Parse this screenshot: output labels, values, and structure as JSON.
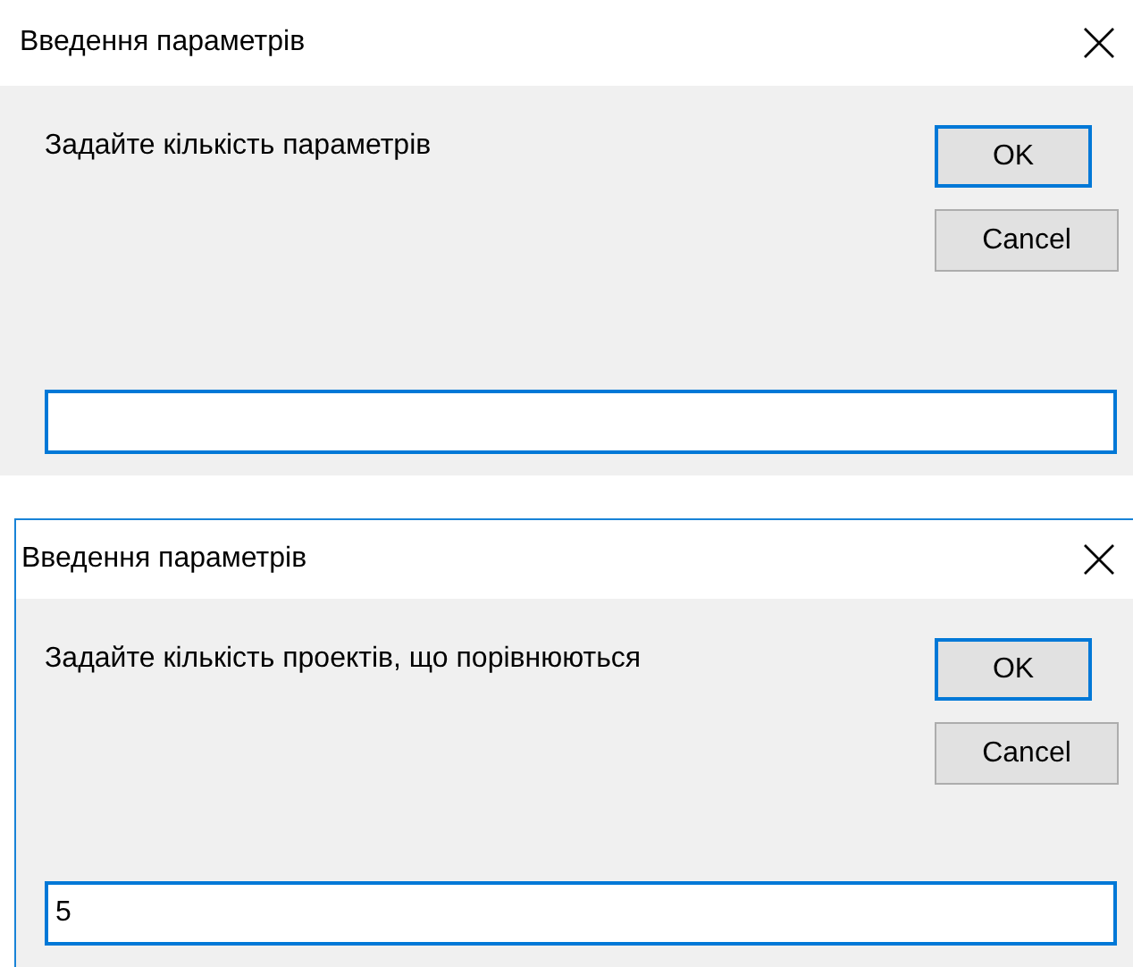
{
  "dialogs": [
    {
      "title": "Введення параметрів",
      "prompt": "Задайте кількість параметрів",
      "buttons": [
        {
          "label": "OK",
          "default": true
        },
        {
          "label": "Cancel",
          "default": false
        }
      ],
      "framed": false
    },
    {
      "title": "Введення параметрів",
      "prompt": "Задайте кількість проектів, що порівнюються",
      "buttons": [
        {
          "label": "OK",
          "default": true
        },
        {
          "label": "Cancel",
          "default": false
        }
      ],
      "input": {
        "value": "5"
      },
      "framed": true
    }
  ]
}
